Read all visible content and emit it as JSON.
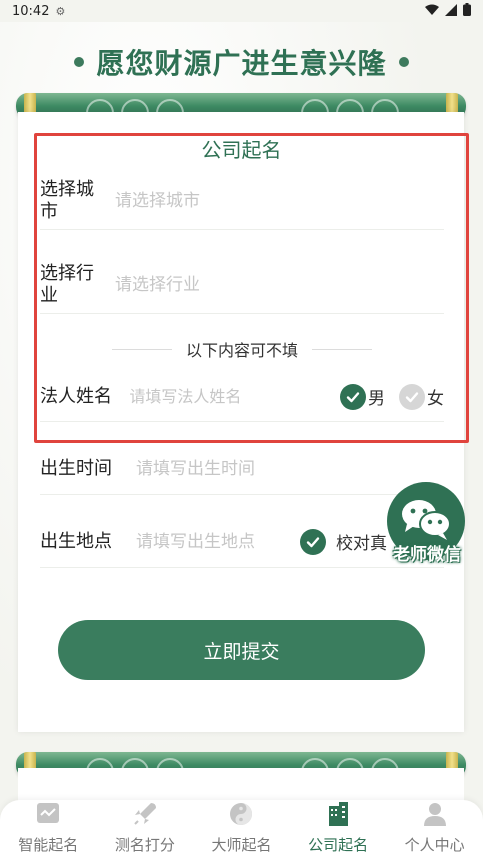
{
  "status": {
    "time": "10:42"
  },
  "banner": {
    "title": "愿您财源广进生意兴隆"
  },
  "form": {
    "title": "公司起名",
    "city_label": "选择城\n市",
    "city_placeholder": "请选择城市",
    "industry_label": "选择行\n业",
    "industry_placeholder": "请选择行业",
    "optional_divider": "以下内容可不填",
    "legal_name_label": "法人姓名",
    "legal_name_placeholder": "请填写法人姓名",
    "gender_male": "男",
    "gender_female": "女",
    "gender_selected": "男",
    "birth_time_label": "出生时间",
    "birth_time_placeholder": "请填写出生时间",
    "birth_place_label": "出生地点",
    "birth_place_placeholder": "请填写出生地点",
    "true_solar_check": "校对真",
    "submit_label": "立即提交"
  },
  "floating": {
    "wechat_label": "老师微信"
  },
  "tabbar": {
    "items": [
      {
        "label": "智能起名",
        "icon": "chart-icon"
      },
      {
        "label": "测名打分",
        "icon": "rocket-icon"
      },
      {
        "label": "大师起名",
        "icon": "yin-yang-icon"
      },
      {
        "label": "公司起名",
        "icon": "building-icon"
      },
      {
        "label": "个人中心",
        "icon": "person-icon"
      }
    ],
    "active": "公司起名"
  },
  "colors": {
    "accent": "#2f7154",
    "highlight_box": "#e0443d"
  }
}
